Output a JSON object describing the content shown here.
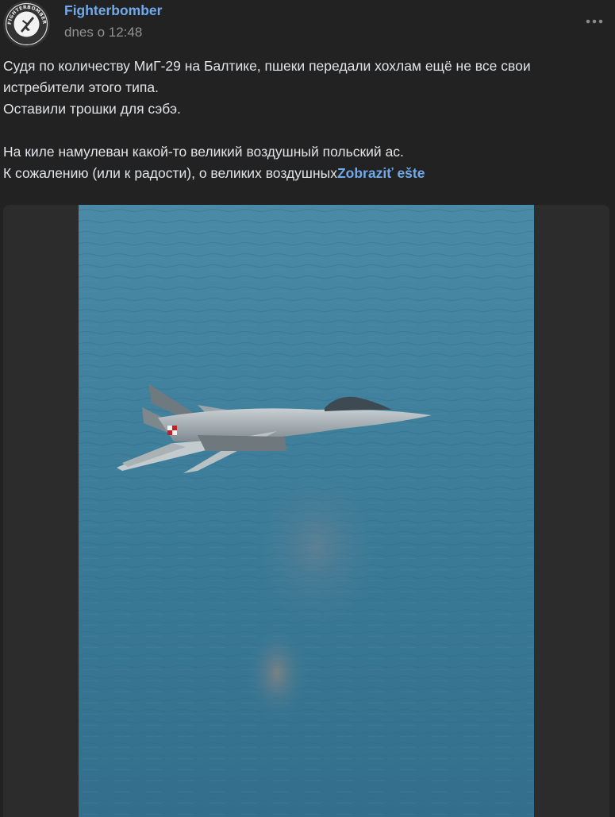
{
  "post": {
    "author": "Fighterbomber",
    "time": "dnes o 12:48",
    "avatar_text": "FIGHTERBOMBER",
    "menu_icon": "more-horizontal-icon",
    "text_lines": [
      "Судя по количеству МиГ-29 на Балтике, пшеки передали хохлам ещё не все свои",
      "истребители этого типа.",
      "Оставили трошки для сэбэ."
    ],
    "text_lines_2": [
      "На киле намулеван какой-то великий воздушный польский ас."
    ],
    "truncated_line": "К сожалению (или к радости), о великих воздушных",
    "show_more": "Zobraziť ešte"
  },
  "colors": {
    "background": "#222222",
    "link": "#71aaeb",
    "text": "#e1e3e6",
    "muted": "#939393",
    "sea": "#3f7f99"
  },
  "photo": {
    "subject": "MiG-29 jet over sea"
  }
}
